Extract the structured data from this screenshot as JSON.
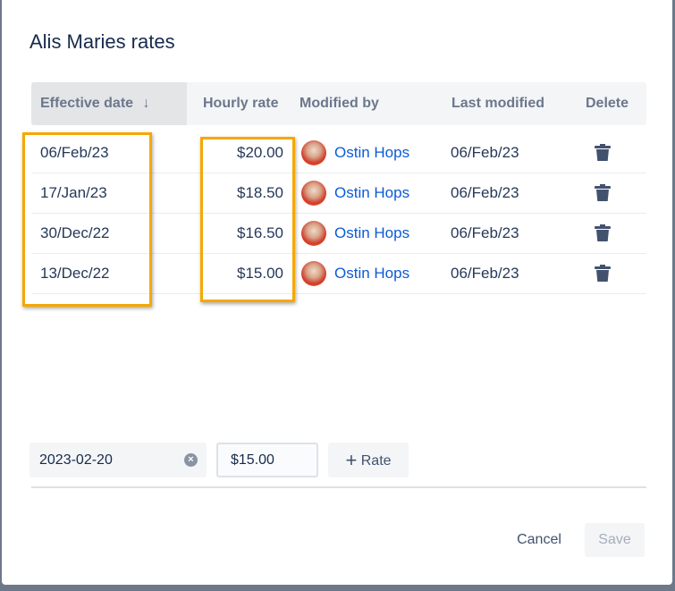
{
  "dialog": {
    "title": "Alis Maries rates"
  },
  "table": {
    "headers": {
      "effective_date": "Effective date",
      "sort_icon": "↓",
      "hourly_rate": "Hourly rate",
      "modified_by": "Modified by",
      "last_modified": "Last modified",
      "delete": "Delete"
    },
    "rows": [
      {
        "effective_date": "06/Feb/23",
        "hourly_rate": "$20.00",
        "modified_by": "Ostin Hops",
        "last_modified": "06/Feb/23"
      },
      {
        "effective_date": "17/Jan/23",
        "hourly_rate": "$18.50",
        "modified_by": "Ostin Hops",
        "last_modified": "06/Feb/23"
      },
      {
        "effective_date": "30/Dec/22",
        "hourly_rate": "$16.50",
        "modified_by": "Ostin Hops",
        "last_modified": "06/Feb/23"
      },
      {
        "effective_date": "13/Dec/22",
        "hourly_rate": "$15.00",
        "modified_by": "Ostin Hops",
        "last_modified": "06/Feb/23"
      }
    ]
  },
  "form": {
    "date_value": "2023-02-20",
    "rate_value": "$15.00",
    "add_rate_label": "Rate"
  },
  "footer": {
    "cancel": "Cancel",
    "save": "Save"
  },
  "colors": {
    "highlight": "#f5a800",
    "link": "#0c5ad6"
  }
}
